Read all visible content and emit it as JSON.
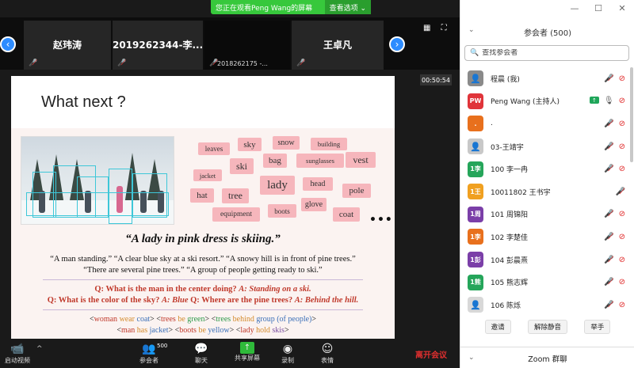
{
  "share_banner": {
    "text": "您正在观看Peng Wang的屏幕",
    "options": "查看选项 ⌄"
  },
  "strip": {
    "tiles": [
      {
        "name": "赵玮涛",
        "sub": ""
      },
      {
        "name": "2019262344-李...",
        "sub": ""
      },
      {
        "name": "",
        "sub": "2018262175 -..."
      },
      {
        "name": "王卓凡",
        "sub": ""
      }
    ]
  },
  "timer": "00:50:54",
  "slide": {
    "title": "What next ?",
    "words": [
      "leaves",
      "sky",
      "snow",
      "building",
      "jacket",
      "ski",
      "bag",
      "sunglasses",
      "vest",
      "hat",
      "tree",
      "lady",
      "head",
      "pole",
      "equipment",
      "boots",
      "glove",
      "coat"
    ],
    "more": "•••",
    "headline": "“A lady in pink dress is skiing.”",
    "captions": [
      "“A man standing.”   “A clear blue sky at a ski resort.”   “A snowy hill is in front of pine trees.”",
      "“There are several pine trees.”   “A group of people getting ready to ski.”"
    ],
    "q1": {
      "q": "Q: What is the man in the center doing? ",
      "a": "A: Standing on a ski."
    },
    "q2": {
      "q1": "Q: What is the color of the sky? ",
      "a1": "A: Blue",
      "q2": "   Q: Where are the pine trees? ",
      "a2": "A: Behind the hill."
    },
    "seq1": [
      {
        "t": "<",
        "c": ""
      },
      {
        "t": "woman",
        "c": "c-red"
      },
      {
        "t": " wear ",
        "c": "c-ora"
      },
      {
        "t": "coat",
        "c": "c-blu"
      },
      {
        "t": "> <",
        "c": ""
      },
      {
        "t": "trees",
        "c": "c-red"
      },
      {
        "t": " be ",
        "c": "c-ora"
      },
      {
        "t": "green",
        "c": "c-grn"
      },
      {
        "t": "> <",
        "c": ""
      },
      {
        "t": "trees",
        "c": "c-grn"
      },
      {
        "t": " behind ",
        "c": "c-ora"
      },
      {
        "t": "group (of people)",
        "c": "c-blu"
      },
      {
        "t": ">",
        "c": ""
      }
    ],
    "seq2": [
      {
        "t": "<",
        "c": ""
      },
      {
        "t": "man",
        "c": "c-red"
      },
      {
        "t": " has ",
        "c": "c-ora"
      },
      {
        "t": "jacket",
        "c": "c-blu"
      },
      {
        "t": "> <",
        "c": ""
      },
      {
        "t": "boots",
        "c": "c-red"
      },
      {
        "t": " be ",
        "c": "c-ora"
      },
      {
        "t": "yellow",
        "c": "c-blu"
      },
      {
        "t": "> <",
        "c": ""
      },
      {
        "t": "lady",
        "c": "c-red"
      },
      {
        "t": " hold ",
        "c": "c-ora"
      },
      {
        "t": "skis",
        "c": "c-pur"
      },
      {
        "t": ">",
        "c": ""
      }
    ]
  },
  "toolbar": {
    "start_video": "启动视频",
    "participants": "参会者",
    "participants_count": "500",
    "chat": "聊天",
    "share_screen": "共享屏幕",
    "record": "录制",
    "reactions": "表情",
    "leave": "离开会议"
  },
  "panel": {
    "title": "参会者 (500)",
    "search_placeholder": "查找参会者",
    "participants": [
      {
        "name": "程晨 (我)",
        "avatar": "",
        "color": "#8a8a8a",
        "mic": "off",
        "video": "off",
        "share": false,
        "photo": true
      },
      {
        "name": "Peng Wang (主持人)",
        "avatar": "PW",
        "color": "#e0343a",
        "mic": "on",
        "video": "off",
        "share": true,
        "photo": false
      },
      {
        "name": ".",
        "avatar": ".",
        "color": "#e8701d",
        "mic": "off",
        "video": "off",
        "share": false,
        "photo": false
      },
      {
        "name": "03-王靖宇",
        "avatar": "",
        "color": "#c8c8c8",
        "mic": "off",
        "video": "off",
        "share": false,
        "photo": true
      },
      {
        "name": "100 李一冉",
        "avatar": "1李",
        "color": "#25a55a",
        "mic": "off",
        "video": "off",
        "share": false,
        "photo": false
      },
      {
        "name": "10011802 王书宇",
        "avatar": "1王",
        "color": "#f0a020",
        "mic": "off",
        "video": "",
        "share": false,
        "photo": false
      },
      {
        "name": "101 周锦阳",
        "avatar": "1周",
        "color": "#7b3fa8",
        "mic": "off",
        "video": "off",
        "share": false,
        "photo": false
      },
      {
        "name": "102 李楚佳",
        "avatar": "1李",
        "color": "#e8701d",
        "mic": "off",
        "video": "off",
        "share": false,
        "photo": false
      },
      {
        "name": "104 彭晨熹",
        "avatar": "1彭",
        "color": "#7b3fa8",
        "mic": "off",
        "video": "off",
        "share": false,
        "photo": false
      },
      {
        "name": "105 熊志辉",
        "avatar": "1熊",
        "color": "#25a55a",
        "mic": "off",
        "video": "off",
        "share": false,
        "photo": false
      },
      {
        "name": "106 陈烁",
        "avatar": "",
        "color": "#d8d8d8",
        "mic": "off",
        "video": "off",
        "share": false,
        "photo": true
      }
    ],
    "actions": [
      "邀请",
      "解除静音",
      "举手"
    ],
    "chat_title": "Zoom 群聊"
  },
  "icons": {
    "prev": "chevron-left-icon",
    "next": "chevron-right-icon",
    "mic_off": "mic-off-icon",
    "video_off": "video-off-icon"
  }
}
